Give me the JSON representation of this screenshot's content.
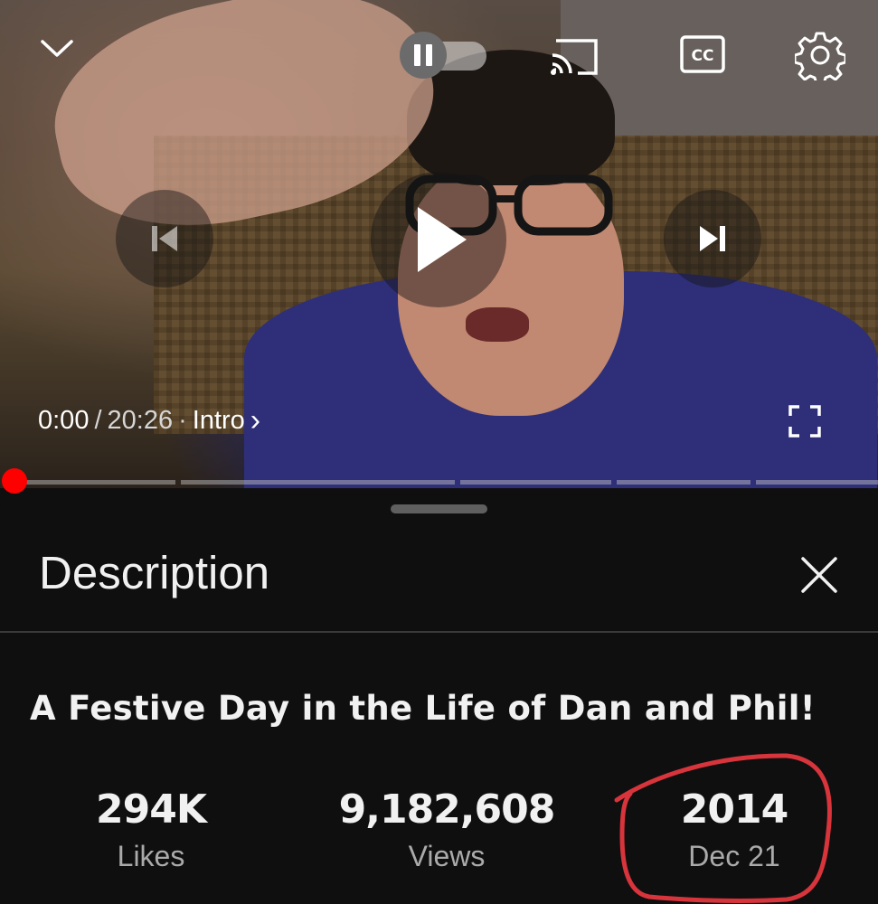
{
  "player": {
    "current_time": "0:00",
    "separator": "/",
    "duration": "20:26",
    "chapter_dot": "·",
    "chapter": "Intro",
    "chapter_arrow": "›",
    "progress_fraction": 0.0,
    "icons": [
      "chevron-down-icon",
      "autoplay-toggle-icon",
      "cast-icon",
      "captions-icon",
      "settings-icon",
      "previous-icon",
      "play-icon",
      "next-icon",
      "fullscreen-icon"
    ],
    "colors": {
      "progress_red": "#ff0000"
    }
  },
  "description": {
    "heading": "Description",
    "close_icon": "close-icon",
    "video_title": "A Festive Day in the Life of Dan and Phil!",
    "stats": [
      {
        "value": "294K",
        "label": "Likes"
      },
      {
        "value": "9,182,608",
        "label": "Views"
      },
      {
        "value": "2014",
        "label": "Dec 21"
      }
    ],
    "annotation_color": "#d8343c"
  }
}
